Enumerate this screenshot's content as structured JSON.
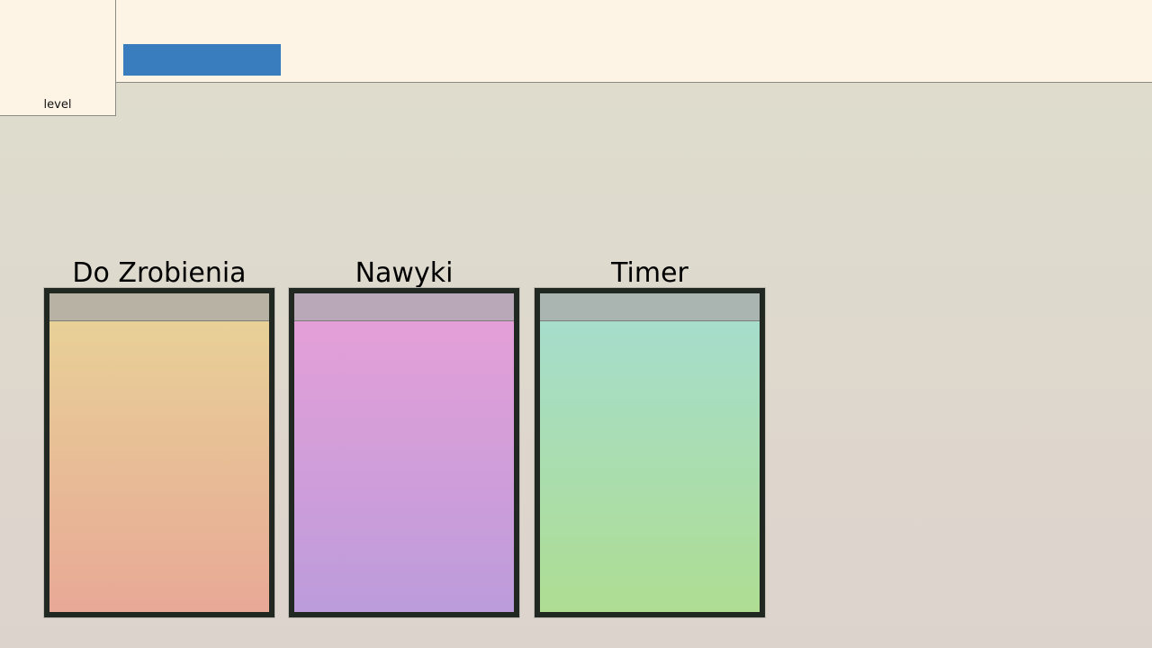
{
  "header": {
    "level_label": "level",
    "accent_color": "#3a7dbf"
  },
  "columns": [
    {
      "title": "Do Zrobienia",
      "top_color": "#e8d097",
      "bottom_color": "#e8a996"
    },
    {
      "title": "Nawyki",
      "top_color": "#e49fd8",
      "bottom_color": "#bc9cdb"
    },
    {
      "title": "Timer",
      "top_color": "#a6ddcc",
      "bottom_color": "#aedd92"
    }
  ]
}
